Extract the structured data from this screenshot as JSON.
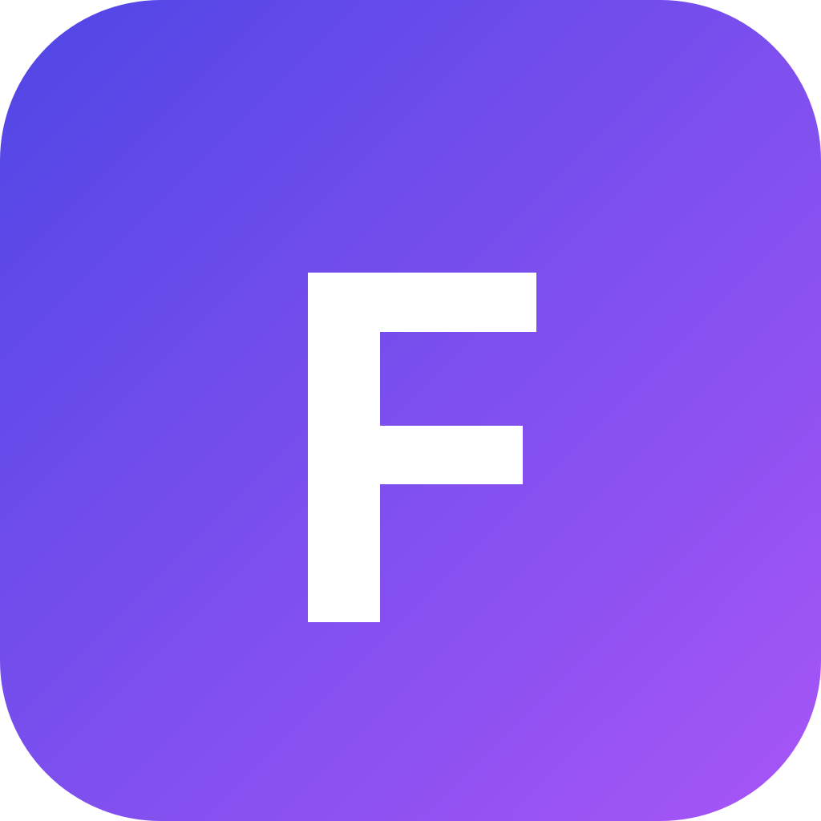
{
  "icon": {
    "letter": "F",
    "letter_color": "#ffffff",
    "gradient": {
      "start": "#4f46e5",
      "mid": "#7c4fee",
      "end": "#a855f7"
    }
  }
}
